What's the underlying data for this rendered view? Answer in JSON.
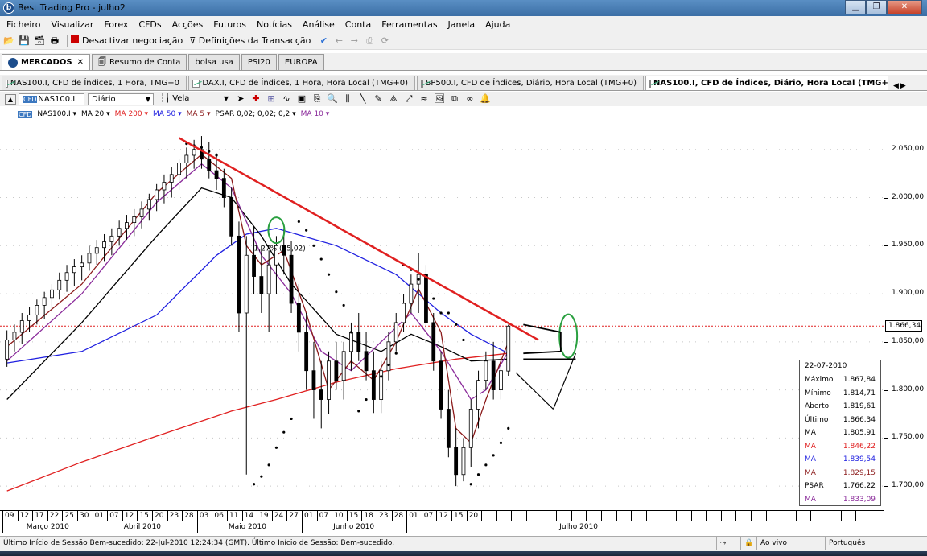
{
  "window": {
    "title": "Best Trading Pro - julho2"
  },
  "menu": [
    "Ficheiro",
    "Visualizar",
    "Forex",
    "CFDs",
    "Acções",
    "Futuros",
    "Notícias",
    "Análise",
    "Conta",
    "Ferramentas",
    "Janela",
    "Ajuda"
  ],
  "toolbar": {
    "deactivate_label": "Desactivar negociação",
    "settings_label": "Definições da Transacção"
  },
  "tabs_top": [
    {
      "label": "MERCADOS",
      "active": true
    },
    {
      "label": "Resumo de Conta"
    },
    {
      "label": "bolsa usa"
    },
    {
      "label": "PSI20"
    },
    {
      "label": "EUROPA"
    }
  ],
  "chart_tabs": [
    {
      "label": "NAS100.I, CFD de Índices, 1 Hora, TMG+0"
    },
    {
      "label": "DAX.I, CFD de Índices, 1 Hora, Hora Local (TMG+0)"
    },
    {
      "label": "SP500.I, CFD de Índices, Diário, Hora Local (TMG+0)"
    },
    {
      "label": "NAS100.I, CFD de Índices, Diário, Hora Local (TMG+0)",
      "active": true
    }
  ],
  "chart_toolbar": {
    "symbol": "NAS100.I",
    "symbol_tag": "CFD",
    "period": "Diário",
    "chart_style": "Vela"
  },
  "indicators": [
    {
      "label": "NAS100.I ▾",
      "color": "#000000"
    },
    {
      "label": "MA 20 ▾",
      "color": "#000000"
    },
    {
      "label": "MA 200 ▾",
      "color": "#e02020"
    },
    {
      "label": "MA 50 ▾",
      "color": "#2020e0"
    },
    {
      "label": "MA 5 ▾",
      "color": "#8b1a1a"
    },
    {
      "label": "PSAR 0,02; 0,02; 0,2 ▾",
      "color": "#000000"
    },
    {
      "label": "MA 10 ▾",
      "color": "#8a2a9a"
    }
  ],
  "chart_data": {
    "type": "candlestick",
    "symbol": "NAS100.I",
    "ylim": [
      1675,
      2095
    ],
    "yticks": [
      "2.050,00",
      "2.000,00",
      "1.950,00",
      "1.900,00",
      "1.850,00",
      "1.800,00",
      "1.750,00",
      "1.700,00"
    ],
    "ytick_values": [
      2050,
      2000,
      1950,
      1900,
      1850,
      1800,
      1750,
      1700
    ],
    "last_price_label": "1.866,34",
    "last_price": 1866.34,
    "annotation": "1,27% (25,02)",
    "x_days": [
      "09",
      "12",
      "17",
      "22",
      "25",
      "30",
      "01",
      "07",
      "12",
      "15",
      "20",
      "23",
      "28",
      "03",
      "06",
      "11",
      "14",
      "19",
      "24",
      "27",
      "01",
      "07",
      "10",
      "15",
      "18",
      "23",
      "28",
      "01",
      "07",
      "12",
      "15",
      "20"
    ],
    "x_months": [
      "Março 2010",
      "Abril 2010",
      "Maio 2010",
      "Junho 2010",
      "Julho 2010"
    ],
    "candles": [
      [
        1832,
        1862,
        1824,
        1852
      ],
      [
        1852,
        1868,
        1840,
        1860
      ],
      [
        1860,
        1880,
        1848,
        1872
      ],
      [
        1872,
        1886,
        1860,
        1878
      ],
      [
        1878,
        1894,
        1868,
        1888
      ],
      [
        1888,
        1902,
        1874,
        1896
      ],
      [
        1896,
        1910,
        1884,
        1904
      ],
      [
        1904,
        1922,
        1894,
        1914
      ],
      [
        1914,
        1930,
        1902,
        1922
      ],
      [
        1922,
        1936,
        1908,
        1928
      ],
      [
        1928,
        1940,
        1914,
        1932
      ],
      [
        1932,
        1950,
        1924,
        1942
      ],
      [
        1942,
        1956,
        1930,
        1948
      ],
      [
        1948,
        1962,
        1934,
        1954
      ],
      [
        1954,
        1968,
        1940,
        1960
      ],
      [
        1960,
        1976,
        1950,
        1968
      ],
      [
        1968,
        1982,
        1956,
        1974
      ],
      [
        1974,
        1988,
        1960,
        1980
      ],
      [
        1980,
        1996,
        1968,
        1988
      ],
      [
        1988,
        2004,
        1976,
        1998
      ],
      [
        1998,
        2014,
        1986,
        2008
      ],
      [
        2008,
        2024,
        1994,
        2016
      ],
      [
        2016,
        2032,
        2000,
        2024
      ],
      [
        2024,
        2040,
        2008,
        2036
      ],
      [
        2036,
        2052,
        2020,
        2044
      ],
      [
        2044,
        2060,
        2030,
        2050
      ],
      [
        2050,
        2064,
        2030,
        2040
      ],
      [
        2040,
        2058,
        2020,
        2028
      ],
      [
        2028,
        2046,
        2008,
        2020
      ],
      [
        2020,
        2030,
        1990,
        2000
      ],
      [
        2000,
        2010,
        1950,
        1960
      ],
      [
        1960,
        1975,
        1860,
        1880
      ],
      [
        1880,
        1960,
        1712,
        1940
      ],
      [
        1940,
        1970,
        1900,
        1918
      ],
      [
        1918,
        1950,
        1880,
        1900
      ],
      [
        1900,
        1945,
        1860,
        1930
      ],
      [
        1930,
        1960,
        1900,
        1950
      ],
      [
        1950,
        1968,
        1920,
        1940
      ],
      [
        1940,
        1955,
        1880,
        1890
      ],
      [
        1890,
        1910,
        1840,
        1860
      ],
      [
        1860,
        1880,
        1800,
        1820
      ],
      [
        1820,
        1850,
        1770,
        1800
      ],
      [
        1800,
        1830,
        1760,
        1790
      ],
      [
        1790,
        1840,
        1775,
        1830
      ],
      [
        1830,
        1850,
        1800,
        1810
      ],
      [
        1810,
        1850,
        1790,
        1840
      ],
      [
        1840,
        1870,
        1820,
        1860
      ],
      [
        1860,
        1880,
        1830,
        1840
      ],
      [
        1840,
        1860,
        1810,
        1820
      ],
      [
        1820,
        1840,
        1776,
        1790
      ],
      [
        1790,
        1830,
        1776,
        1820
      ],
      [
        1820,
        1860,
        1810,
        1850
      ],
      [
        1850,
        1880,
        1840,
        1870
      ],
      [
        1870,
        1900,
        1860,
        1890
      ],
      [
        1890,
        1920,
        1880,
        1910
      ],
      [
        1910,
        1942,
        1880,
        1920
      ],
      [
        1920,
        1930,
        1860,
        1870
      ],
      [
        1870,
        1880,
        1820,
        1830
      ],
      [
        1830,
        1840,
        1770,
        1780
      ],
      [
        1780,
        1800,
        1730,
        1740
      ],
      [
        1740,
        1760,
        1700,
        1712
      ],
      [
        1712,
        1750,
        1705,
        1740
      ],
      [
        1740,
        1790,
        1720,
        1780
      ],
      [
        1780,
        1820,
        1760,
        1810
      ],
      [
        1810,
        1840,
        1800,
        1830
      ],
      [
        1830,
        1850,
        1790,
        1800
      ],
      [
        1800,
        1840,
        1790,
        1820
      ],
      [
        1819.61,
        1867.84,
        1814.71,
        1866.34
      ]
    ],
    "series": [
      {
        "name": "MA 200",
        "color": "#e02020",
        "points": [
          [
            0,
            1695
          ],
          [
            10,
            1725
          ],
          [
            20,
            1752
          ],
          [
            30,
            1778
          ],
          [
            36,
            1790
          ],
          [
            44,
            1808
          ],
          [
            52,
            1822
          ],
          [
            60,
            1832
          ],
          [
            67,
            1838
          ]
        ]
      },
      {
        "name": "MA 50",
        "color": "#2020e0",
        "points": [
          [
            0,
            1828
          ],
          [
            10,
            1840
          ],
          [
            20,
            1878
          ],
          [
            28,
            1940
          ],
          [
            32,
            1962
          ],
          [
            36,
            1968
          ],
          [
            44,
            1950
          ],
          [
            52,
            1920
          ],
          [
            58,
            1880
          ],
          [
            62,
            1858
          ],
          [
            67,
            1838
          ]
        ]
      },
      {
        "name": "MA 20",
        "color": "#000000",
        "points": [
          [
            0,
            1790
          ],
          [
            10,
            1870
          ],
          [
            20,
            1960
          ],
          [
            26,
            2010
          ],
          [
            30,
            2000
          ],
          [
            34,
            1960
          ],
          [
            38,
            1910
          ],
          [
            44,
            1858
          ],
          [
            50,
            1840
          ],
          [
            54,
            1858
          ],
          [
            58,
            1845
          ],
          [
            62,
            1830
          ],
          [
            67,
            1832
          ]
        ]
      },
      {
        "name": "MA 10",
        "color": "#8a2a9a",
        "points": [
          [
            0,
            1830
          ],
          [
            10,
            1900
          ],
          [
            20,
            1995
          ],
          [
            26,
            2035
          ],
          [
            30,
            2010
          ],
          [
            34,
            1940
          ],
          [
            38,
            1900
          ],
          [
            42,
            1840
          ],
          [
            46,
            1820
          ],
          [
            50,
            1850
          ],
          [
            54,
            1880
          ],
          [
            58,
            1840
          ],
          [
            62,
            1790
          ],
          [
            64,
            1800
          ],
          [
            67,
            1840
          ]
        ]
      },
      {
        "name": "MA 5",
        "color": "#8b1a1a",
        "points": [
          [
            0,
            1845
          ],
          [
            10,
            1910
          ],
          [
            20,
            2005
          ],
          [
            26,
            2045
          ],
          [
            30,
            2020
          ],
          [
            32,
            1950
          ],
          [
            34,
            1930
          ],
          [
            37,
            1945
          ],
          [
            40,
            1880
          ],
          [
            43,
            1800
          ],
          [
            46,
            1830
          ],
          [
            49,
            1810
          ],
          [
            52,
            1850
          ],
          [
            55,
            1905
          ],
          [
            58,
            1860
          ],
          [
            60,
            1760
          ],
          [
            62,
            1745
          ],
          [
            64,
            1790
          ],
          [
            66,
            1830
          ],
          [
            67,
            1850
          ]
        ]
      }
    ],
    "psar": [
      [
        24,
        2056
      ],
      [
        25,
        2054
      ],
      [
        26,
        2052
      ],
      [
        27,
        2048
      ],
      [
        28,
        2044
      ],
      [
        33,
        1702
      ],
      [
        34,
        1710
      ],
      [
        35,
        1722
      ],
      [
        36,
        1740
      ],
      [
        37,
        1756
      ],
      [
        38,
        1770
      ],
      [
        39,
        1975
      ],
      [
        40,
        1966
      ],
      [
        41,
        1950
      ],
      [
        42,
        1936
      ],
      [
        43,
        1920
      ],
      [
        44,
        1902
      ],
      [
        45,
        1888
      ],
      [
        46,
        1860
      ],
      [
        47,
        1778
      ],
      [
        48,
        1790
      ],
      [
        49,
        1802
      ],
      [
        50,
        1814
      ],
      [
        51,
        1826
      ],
      [
        52,
        1838
      ],
      [
        53,
        1930
      ],
      [
        54,
        1925
      ],
      [
        55,
        1915
      ],
      [
        56,
        1905
      ],
      [
        57,
        1895
      ],
      [
        58,
        1880
      ],
      [
        59,
        1880
      ],
      [
        60,
        1868
      ],
      [
        61,
        1852
      ],
      [
        62,
        1702
      ],
      [
        63,
        1712
      ],
      [
        64,
        1722
      ],
      [
        65,
        1732
      ],
      [
        66,
        1745
      ],
      [
        67,
        1760
      ]
    ],
    "trendline": {
      "color": "#e02020",
      "from": [
        23,
        2062
      ],
      "to": [
        71,
        1852
      ]
    },
    "info_box": {
      "date": "22-07-2010",
      "rows": [
        {
          "label": "Máximo",
          "value": "1.867,84",
          "color": "#000000"
        },
        {
          "label": "Mínimo",
          "value": "1.814,71",
          "color": "#000000"
        },
        {
          "label": "Aberto",
          "value": "1.819,61",
          "color": "#000000"
        },
        {
          "label": "Último",
          "value": "1.866,34",
          "color": "#000000"
        },
        {
          "label": "MA",
          "value": "1.805,91",
          "color": "#000000"
        },
        {
          "label": "MA",
          "value": "1.846,22",
          "color": "#e02020"
        },
        {
          "label": "MA",
          "value": "1.839,54",
          "color": "#2020e0"
        },
        {
          "label": "MA",
          "value": "1.829,15",
          "color": "#8b1a1a"
        },
        {
          "label": "PSAR",
          "value": "1.766,22",
          "color": "#000000"
        },
        {
          "label": "MA",
          "value": "1.833,09",
          "color": "#8a2a9a"
        }
      ]
    }
  },
  "status": {
    "message": "Último Início de Sessão Bem-sucedido: 22-Jul-2010 12:24:34 (GMT). Último Início de Sessão: Bem-sucedido.",
    "live": "Ao vivo",
    "language": "Português"
  }
}
